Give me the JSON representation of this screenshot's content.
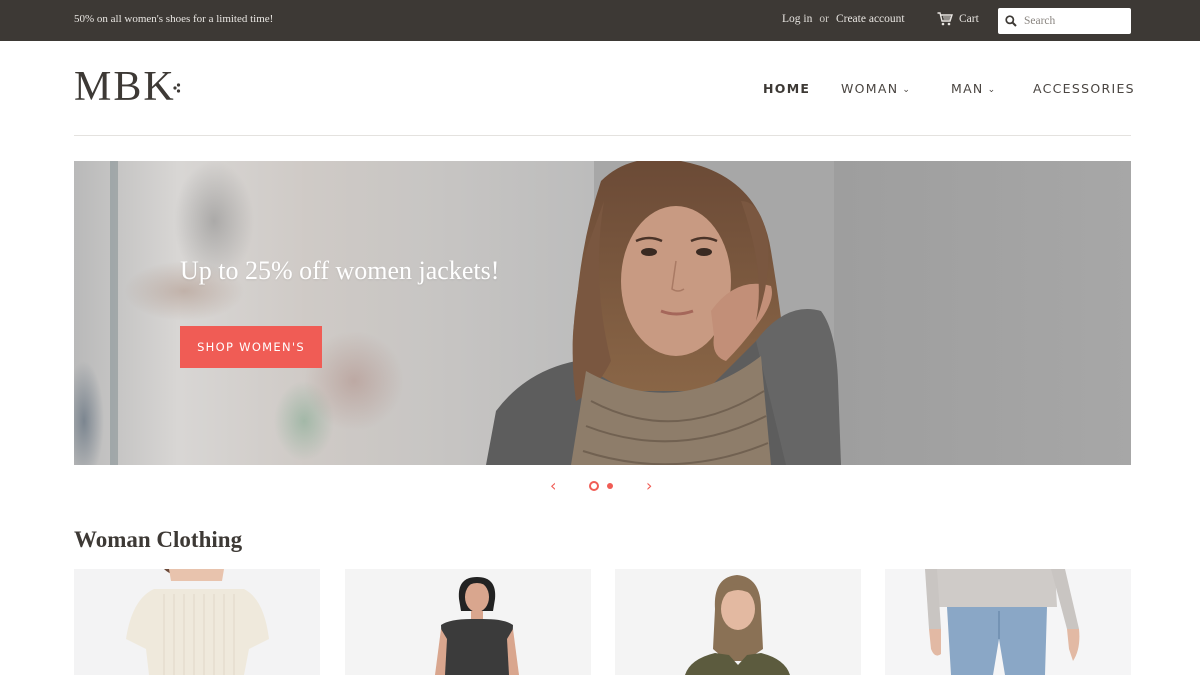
{
  "announcement": {
    "text": "50% on all women's shoes for a limited time!",
    "login_label": "Log in",
    "or_label": "or",
    "create_account_label": "Create account",
    "cart_label": "Cart",
    "cart_icon": "cart-icon",
    "search_icon": "search-icon",
    "search_placeholder": "Search",
    "search_value": ""
  },
  "header": {
    "logo_text": "MBK",
    "nav": [
      {
        "label": "HOME",
        "active": true,
        "dropdown": false
      },
      {
        "label": "WOMAN",
        "active": false,
        "dropdown": true
      },
      {
        "label": "MAN",
        "active": false,
        "dropdown": true
      },
      {
        "label": "ACCESSORIES",
        "active": false,
        "dropdown": false
      }
    ],
    "dropdown_glyph": "⌄"
  },
  "hero": {
    "headline": "Up to 25% off women jackets!",
    "cta_label": "SHOP WOMEN'S",
    "prev_glyph": "‹",
    "next_glyph": "›",
    "slide_count": 2,
    "active_slide": 1
  },
  "collection": {
    "title": "Woman Clothing",
    "products": [
      {
        "image": "cream pleated top"
      },
      {
        "image": "black sleeveless top"
      },
      {
        "image": "olive v-neck tee"
      },
      {
        "image": "grey sweatshirt with jeans"
      }
    ]
  },
  "colors": {
    "topbar_bg": "#3d3935",
    "accent": "#f05c55",
    "text": "#3d3935"
  }
}
